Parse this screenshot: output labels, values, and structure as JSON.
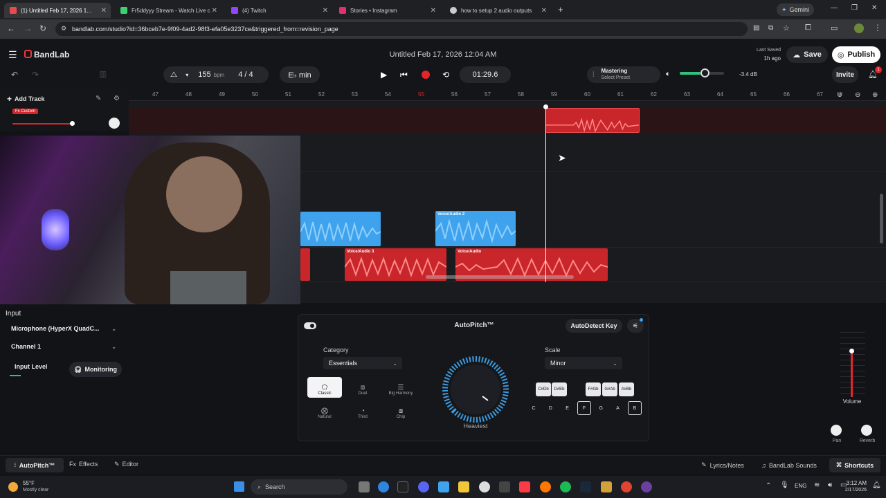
{
  "browser": {
    "tabs": [
      {
        "label": "(1) Untitled Feb 17, 2026 1…",
        "color": "#e94b4b"
      },
      {
        "label": "Fr5ddyyy Stream - Watch Live c",
        "color": "#3cd070"
      },
      {
        "label": "(4) Twitch",
        "color": "#9146ff"
      },
      {
        "label": "Stories • Instagram",
        "color": "#e1306c"
      },
      {
        "label": "how to setup 2 audio outputs",
        "color": "#cccccc"
      }
    ],
    "gemini": "Gemini",
    "url": "bandlab.com/studio?id=36bceb7e-9f09-4ad2-98f3-efa05e3237ce&triggered_from=revision_page"
  },
  "app": {
    "brand": "BandLab",
    "project_title": "Untitled Feb 17, 2026 12:04 AM",
    "last_saved_label": "Last Saved",
    "last_saved_value": "1h ago",
    "save": "Save",
    "publish": "Publish",
    "invite": "Invite",
    "notif_count": "1"
  },
  "transport": {
    "bpm": "155",
    "bpm_unit": "bpm",
    "time_sig": "4 / 4",
    "key": "E♭ min",
    "time": "01:29.6",
    "mastering": "Mastering",
    "select_preset": "Select Preset",
    "volume_db": "-3.4 dB"
  },
  "ruler": [
    "47",
    "48",
    "49",
    "50",
    "51",
    "52",
    "53",
    "54",
    "55",
    "56",
    "57",
    "58",
    "59",
    "60",
    "61",
    "62",
    "63",
    "64",
    "65",
    "66",
    "67"
  ],
  "tracks": {
    "add_track": "Add Track",
    "fx_badge": "Fx Custom",
    "clips": [
      {
        "label": "Voice/Audio 2"
      },
      {
        "label": "Voice/Audio 3"
      },
      {
        "label": "Voice/Audio"
      }
    ]
  },
  "input_panel": {
    "input_label": "Input",
    "device": "Microphone (HyperX QuadC...",
    "channel": "Channel 1",
    "input_level": "Input Level",
    "monitoring": "Monitoring"
  },
  "autopitch": {
    "title": "AutoPitch™",
    "autodetect": "AutoDetect Key",
    "category_label": "Category",
    "category_value": "Essentials",
    "modes": [
      "Classic",
      "Duet",
      "Big Harmony",
      "Natural",
      "Third",
      "Chip"
    ],
    "selected_mode": "Classic",
    "amount_label": "Heaviest",
    "scale_label": "Scale",
    "scale_value": "Minor",
    "sharps": [
      [
        "C#",
        "Db"
      ],
      [
        "D#",
        "Eb"
      ],
      [
        "F#",
        "Gb"
      ],
      [
        "G#",
        "Ab"
      ],
      [
        "A#",
        "Bb"
      ]
    ],
    "naturals": [
      "C",
      "D",
      "E",
      "F",
      "G",
      "A",
      "B"
    ]
  },
  "mixer": {
    "volume": "Volume",
    "pan": "Pan",
    "reverb": "Reverb"
  },
  "bottombar": {
    "autopitch": "AutoPitch™",
    "effects": "Effects",
    "editor": "Editor",
    "lyrics": "Lyrics/Notes",
    "sounds": "BandLab Sounds",
    "shortcuts": "Shortcuts"
  },
  "taskbar": {
    "weather_temp": "55°F",
    "weather_desc": "Mostly clear",
    "search": "Search",
    "lang": "ENG",
    "time": "3:12 AM",
    "date": "2/17/2026"
  },
  "colors": {
    "accent_red": "#e0262b",
    "accent_blue": "#3ea2ec",
    "bg": "#121316"
  }
}
